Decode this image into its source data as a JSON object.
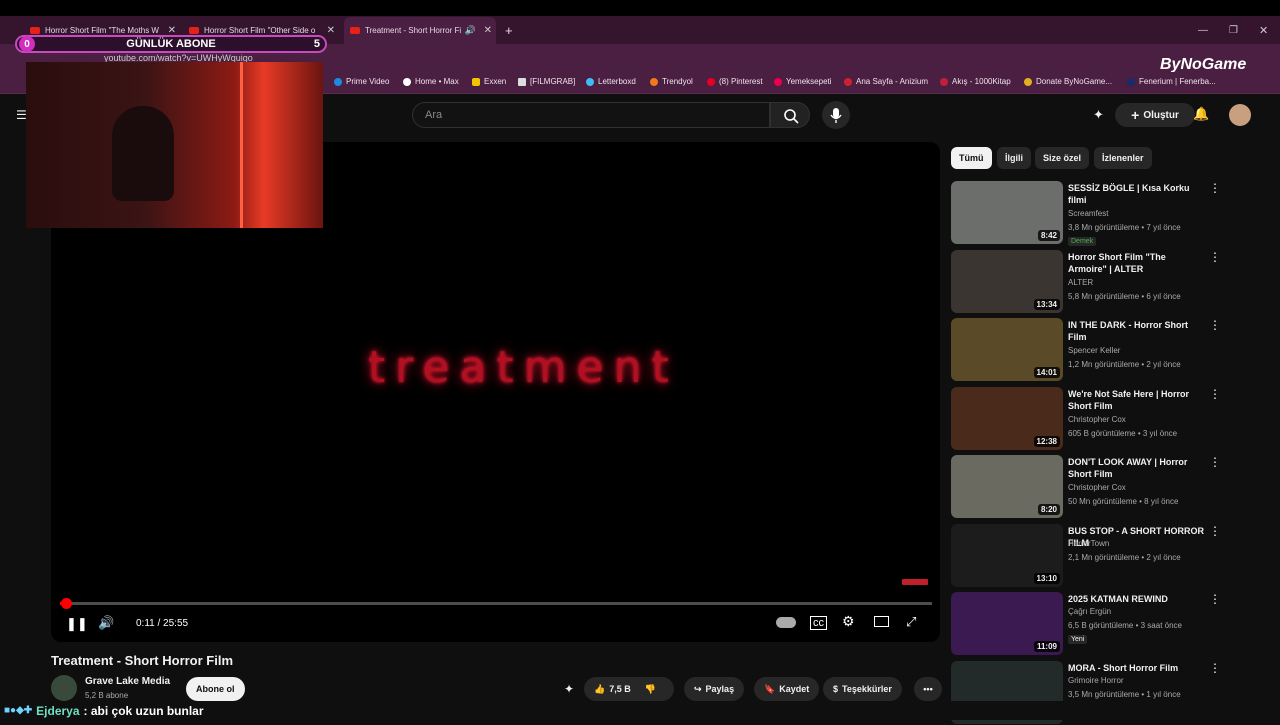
{
  "browser": {
    "tabs": [
      {
        "label": "Horror Short Film \"The Moths W"
      },
      {
        "label": "Horror Short Film \"Other Side o"
      },
      {
        "label": "Treatment - Short Horror Fi"
      }
    ],
    "url": "youtube.com/watch?v=UWHyWquigo",
    "bookmarks": [
      "Prime Video",
      "Home • Max",
      "Exxen",
      "[FILMGRAB]",
      "Letterboxd",
      "Trendyol",
      "(8) Pinterest",
      "Yemeksepeti",
      "Ana Sayfa - Anizium",
      "Akış - 1000Kitap",
      "Donate ByNoGame...",
      "Fenerium | Fenerba..."
    ]
  },
  "stream_overlay": {
    "sub_label": "GÜNLÜK ABONE",
    "sub_left": "0",
    "sub_right": "5",
    "logo": "ByNoGame"
  },
  "youtube": {
    "search_placeholder": "Ara",
    "create_label": "Oluştur",
    "player": {
      "art_text": "treatment",
      "time": "0:11 / 25:55",
      "progress": 0.007
    },
    "video": {
      "title": "Treatment - Short Horror Film",
      "channel": "Grave Lake Media",
      "subs": "5,2 B abone",
      "subscribe": "Abone ol",
      "likes": "7,5 B",
      "share": "Paylaş",
      "save": "Kaydet",
      "thanks": "Teşekkürler"
    },
    "chips": [
      "Tümü",
      "İlgili",
      "Size özel",
      "İzlenenler"
    ],
    "recommended": [
      {
        "title": "SESSİZ BÖGLE | Kısa Korku filmi",
        "channel": "Screamfest",
        "meta": "3,8 Mn görüntüleme • 7 yıl önce",
        "duration": "8:42",
        "badge": "Demek",
        "color": "#6b6e6a"
      },
      {
        "title": "Horror Short Film \"The Armoire\" | ALTER",
        "channel": "ALTER",
        "meta": "5,8 Mn görüntüleme • 6 yıl önce",
        "duration": "13:34",
        "color": "#3a3531"
      },
      {
        "title": "IN THE DARK - Horror Short Film",
        "channel": "Spencer Keller",
        "meta": "1,2 Mn görüntüleme • 2 yıl önce",
        "duration": "14:01",
        "color": "#5a4a28"
      },
      {
        "title": "We're Not Safe Here | Horror Short Film",
        "channel": "Christopher Cox",
        "meta": "605 B görüntüleme • 3 yıl önce",
        "duration": "12:38",
        "color": "#4a2a1a"
      },
      {
        "title": "DON'T LOOK AWAY | Horror Short Film",
        "channel": "Christopher Cox",
        "meta": "50 Mn görüntüleme • 8 yıl önce",
        "duration": "8:20",
        "color": "#6a6a60"
      },
      {
        "title": "BUS STOP - A SHORT HORROR FILM",
        "channel": "HorrorTown",
        "meta": "2,1 Mn görüntüleme • 2 yıl önce",
        "duration": "13:10",
        "color": "#1c1c1c"
      },
      {
        "title": "2025 KATMAN REWIND",
        "channel": "Çağrı Ergün",
        "meta": "6,5 B görüntüleme • 3 saat önce",
        "duration": "11:09",
        "badge": "Yeni",
        "color": "#3a1a50"
      },
      {
        "title": "MORA - Short Horror Film",
        "channel": "Grimoire Horror",
        "meta": "3,5 Mn görüntüleme • 1 yıl önce",
        "duration": "",
        "color": "#222a2a"
      }
    ]
  },
  "chat": {
    "user": "Ejderya",
    "message": ": abi çok uzun bunlar"
  }
}
